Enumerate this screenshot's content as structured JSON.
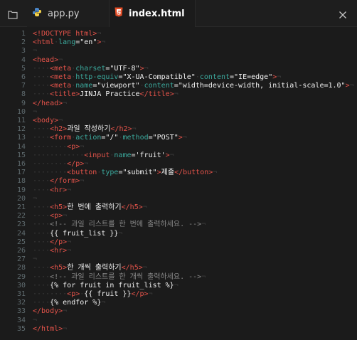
{
  "tabs": [
    {
      "label": "app.py",
      "icon": "python-icon",
      "active": false
    },
    {
      "label": "index.html",
      "icon": "html5-icon",
      "active": true
    }
  ],
  "colors": {
    "tag": "#e4534a",
    "attr": "#3ba99d",
    "text": "#f2f2f2",
    "comment": "#8a8a8a",
    "whitespace": "#3c3c3c",
    "line_number": "#5f6b6f"
  },
  "lines": [
    {
      "n": "1",
      "tokens": [
        [
          "tag",
          "<!DOCTYPE html>"
        ],
        [
          "ws",
          "¬"
        ]
      ]
    },
    {
      "n": "2",
      "tokens": [
        [
          "tag",
          "<html"
        ],
        [
          "ws",
          "·"
        ],
        [
          "attr",
          "lang"
        ],
        [
          "text",
          "=\"en\""
        ],
        [
          "tag",
          ">"
        ],
        [
          "ws",
          "¬"
        ]
      ]
    },
    {
      "n": "3",
      "tokens": [
        [
          "ws",
          "¬"
        ]
      ]
    },
    {
      "n": "4",
      "tokens": [
        [
          "tag",
          "<head>"
        ],
        [
          "ws",
          "¬"
        ]
      ]
    },
    {
      "n": "5",
      "tokens": [
        [
          "ws",
          "····"
        ],
        [
          "tag",
          "<meta"
        ],
        [
          "ws",
          "·"
        ],
        [
          "attr",
          "charset"
        ],
        [
          "text",
          "=\"UTF-8\""
        ],
        [
          "tag",
          ">"
        ],
        [
          "ws",
          "¬"
        ]
      ]
    },
    {
      "n": "6",
      "tokens": [
        [
          "ws",
          "····"
        ],
        [
          "tag",
          "<meta"
        ],
        [
          "ws",
          "·"
        ],
        [
          "attr",
          "http-equiv"
        ],
        [
          "text",
          "=\"X-UA-Compatible\""
        ],
        [
          "ws",
          "·"
        ],
        [
          "attr",
          "content"
        ],
        [
          "text",
          "=\"IE=edge\""
        ],
        [
          "tag",
          ">"
        ],
        [
          "ws",
          "¬"
        ]
      ]
    },
    {
      "n": "7",
      "tokens": [
        [
          "ws",
          "····"
        ],
        [
          "tag",
          "<meta"
        ],
        [
          "ws",
          "·"
        ],
        [
          "attr",
          "name"
        ],
        [
          "text",
          "=\"viewport\""
        ],
        [
          "ws",
          "·"
        ],
        [
          "attr",
          "content"
        ],
        [
          "text",
          "=\"width=device-width, initial-scale=1.0\""
        ],
        [
          "tag",
          ">"
        ],
        [
          "ws",
          "¬"
        ]
      ]
    },
    {
      "n": "8",
      "tokens": [
        [
          "ws",
          "····"
        ],
        [
          "tag",
          "<title>"
        ],
        [
          "text",
          "JINJA Practice"
        ],
        [
          "tag",
          "</title>"
        ],
        [
          "ws",
          "¬"
        ]
      ]
    },
    {
      "n": "9",
      "tokens": [
        [
          "tag",
          "</head>"
        ],
        [
          "ws",
          "¬"
        ]
      ]
    },
    {
      "n": "10",
      "tokens": [
        [
          "ws",
          "¬"
        ]
      ]
    },
    {
      "n": "11",
      "tokens": [
        [
          "tag",
          "<body>"
        ],
        [
          "ws",
          "¬"
        ]
      ]
    },
    {
      "n": "12",
      "tokens": [
        [
          "ws",
          "····"
        ],
        [
          "tag",
          "<h2>"
        ],
        [
          "text",
          "과일 작성하기"
        ],
        [
          "tag",
          "</h2>"
        ],
        [
          "ws",
          "¬"
        ]
      ]
    },
    {
      "n": "13",
      "tokens": [
        [
          "ws",
          "····"
        ],
        [
          "tag",
          "<form"
        ],
        [
          "ws",
          "·"
        ],
        [
          "attr",
          "action"
        ],
        [
          "text",
          "=\"/\""
        ],
        [
          "ws",
          "·"
        ],
        [
          "attr",
          "method"
        ],
        [
          "text",
          "=\"POST\""
        ],
        [
          "tag",
          ">"
        ],
        [
          "ws",
          "¬"
        ]
      ]
    },
    {
      "n": "14",
      "tokens": [
        [
          "ws",
          "········"
        ],
        [
          "tag",
          "<p>"
        ],
        [
          "ws",
          "¬"
        ]
      ]
    },
    {
      "n": "15",
      "tokens": [
        [
          "ws",
          "············"
        ],
        [
          "tag",
          "<input"
        ],
        [
          "ws",
          "·"
        ],
        [
          "attr",
          "name"
        ],
        [
          "text",
          "='fruit'"
        ],
        [
          "tag",
          ">"
        ],
        [
          "ws",
          "¬"
        ]
      ]
    },
    {
      "n": "16",
      "tokens": [
        [
          "ws",
          "········"
        ],
        [
          "tag",
          "</p>"
        ],
        [
          "ws",
          "¬"
        ]
      ]
    },
    {
      "n": "17",
      "tokens": [
        [
          "ws",
          "········"
        ],
        [
          "tag",
          "<button"
        ],
        [
          "ws",
          "·"
        ],
        [
          "attr",
          "type"
        ],
        [
          "text",
          "=\"submit\""
        ],
        [
          "tag",
          ">"
        ],
        [
          "text",
          "제출"
        ],
        [
          "tag",
          "</button>"
        ],
        [
          "ws",
          "¬"
        ]
      ]
    },
    {
      "n": "18",
      "tokens": [
        [
          "ws",
          "····"
        ],
        [
          "tag",
          "</form>"
        ],
        [
          "ws",
          "¬"
        ]
      ]
    },
    {
      "n": "19",
      "tokens": [
        [
          "ws",
          "····"
        ],
        [
          "tag",
          "<hr>"
        ],
        [
          "ws",
          "¬"
        ]
      ]
    },
    {
      "n": "20",
      "tokens": [
        [
          "ws",
          "¬"
        ]
      ]
    },
    {
      "n": "21",
      "tokens": [
        [
          "ws",
          "····"
        ],
        [
          "tag",
          "<h5>"
        ],
        [
          "text",
          "한 번에 출력하기"
        ],
        [
          "tag",
          "</h5>"
        ],
        [
          "ws",
          "¬"
        ]
      ]
    },
    {
      "n": "22",
      "tokens": [
        [
          "ws",
          "····"
        ],
        [
          "tag",
          "<p>"
        ],
        [
          "ws",
          "¬"
        ]
      ]
    },
    {
      "n": "23",
      "tokens": [
        [
          "ws",
          "····"
        ],
        [
          "cmt",
          "<!-- 과일 리스트를 한 번에 출력하세요. -->"
        ],
        [
          "ws",
          "¬"
        ]
      ]
    },
    {
      "n": "24",
      "tokens": [
        [
          "ws",
          "····"
        ],
        [
          "tpl",
          "{{ fruit_list }}"
        ],
        [
          "ws",
          "¬"
        ]
      ]
    },
    {
      "n": "25",
      "tokens": [
        [
          "ws",
          "····"
        ],
        [
          "tag",
          "</p>"
        ],
        [
          "ws",
          "¬"
        ]
      ]
    },
    {
      "n": "26",
      "tokens": [
        [
          "ws",
          "····"
        ],
        [
          "tag",
          "<hr>"
        ],
        [
          "ws",
          "¬"
        ]
      ]
    },
    {
      "n": "27",
      "tokens": [
        [
          "ws",
          "¬"
        ]
      ]
    },
    {
      "n": "28",
      "tokens": [
        [
          "ws",
          "····"
        ],
        [
          "tag",
          "<h5>"
        ],
        [
          "text",
          "한 개씩 출력하기"
        ],
        [
          "tag",
          "</h5>"
        ],
        [
          "ws",
          "¬"
        ]
      ]
    },
    {
      "n": "29",
      "tokens": [
        [
          "ws",
          "····"
        ],
        [
          "cmt",
          "<!-- 과일 리스트를 한 개씩 출력하세요. -->"
        ],
        [
          "ws",
          "¬"
        ]
      ]
    },
    {
      "n": "30",
      "tokens": [
        [
          "ws",
          "····"
        ],
        [
          "tpl",
          "{% for fruit in fruit_list %}"
        ],
        [
          "ws",
          "¬"
        ]
      ]
    },
    {
      "n": "31",
      "tokens": [
        [
          "ws",
          "········"
        ],
        [
          "tag",
          "<p>"
        ],
        [
          "ws",
          "·"
        ],
        [
          "tpl",
          "{{ fruit }}"
        ],
        [
          "tag",
          "</p>"
        ],
        [
          "ws",
          "¬"
        ]
      ]
    },
    {
      "n": "32",
      "tokens": [
        [
          "ws",
          "····"
        ],
        [
          "tpl",
          "{% endfor %}"
        ],
        [
          "ws",
          "¬"
        ]
      ]
    },
    {
      "n": "33",
      "tokens": [
        [
          "tag",
          "</body>"
        ],
        [
          "ws",
          "¬"
        ]
      ]
    },
    {
      "n": "34",
      "tokens": [
        [
          "ws",
          "¬"
        ]
      ]
    },
    {
      "n": "35",
      "tokens": [
        [
          "tag",
          "</html>"
        ],
        [
          "ws",
          "¬"
        ]
      ]
    }
  ]
}
